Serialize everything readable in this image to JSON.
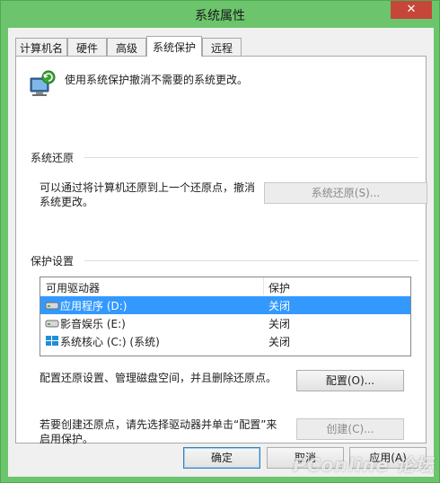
{
  "window": {
    "title": "系统属性",
    "close_label": "✕"
  },
  "tabs": [
    {
      "label": "计算机名"
    },
    {
      "label": "硬件"
    },
    {
      "label": "高级"
    },
    {
      "label": "系统保护"
    },
    {
      "label": "远程"
    }
  ],
  "active_tab": "系统保护",
  "intro": {
    "text": "使用系统保护撤消不需要的系统更改。",
    "icon": "system-protection-icon"
  },
  "restore": {
    "title": "系统还原",
    "description_line1": "可以通过将计算机还原到上一个还原点，撤消",
    "description_line2": "系统更改。",
    "button_label": "系统还原(S)..."
  },
  "protection": {
    "title": "保护设置",
    "columns": [
      "可用驱动器",
      "保护"
    ],
    "drives": [
      {
        "name": "应用程序 (D:)",
        "status": "关闭",
        "icon": "drive-icon",
        "selected": true
      },
      {
        "name": "影音娱乐 (E:)",
        "status": "关闭",
        "icon": "drive-icon",
        "selected": false
      },
      {
        "name": "系统核心 (C:) (系统)",
        "status": "关闭",
        "icon": "windows-drive-icon",
        "selected": false
      }
    ]
  },
  "configure": {
    "text": "配置还原设置、管理磁盘空间，并且删除还原点。",
    "button_label": "配置(O)..."
  },
  "create": {
    "text_line1": "若要创建还原点，请先选择驱动器并单击“配置”来",
    "text_line2": "启用保护。",
    "button_label": "创建(C)..."
  },
  "footer": {
    "ok_label": "确定",
    "cancel_label": "取消",
    "apply_label": "应用(A)"
  },
  "watermark": "PConline 论坛",
  "colors": {
    "frame": "#6cc56c",
    "selection": "#3399ff",
    "close": "#c7463a"
  }
}
